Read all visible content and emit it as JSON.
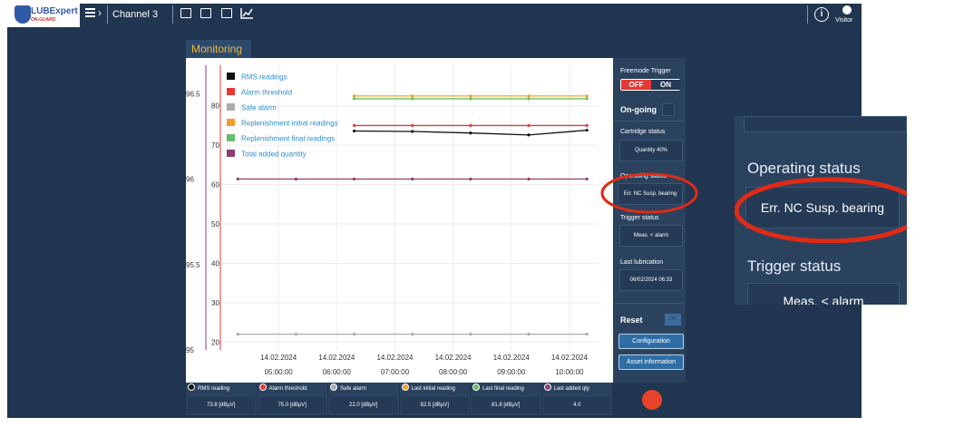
{
  "header": {
    "logo": "LUBExpert",
    "logo_sub": "ON-GUARD",
    "channel": "Channel 3",
    "user_label": "Visitor"
  },
  "panel": {
    "title": "Monitoring"
  },
  "right_panel": {
    "freemode_label": "Freemode Trigger",
    "off_label": "OFF",
    "on_label": "ON",
    "ongoing_label": "On-going",
    "cartridge_label": "Cartridge status",
    "cartridge_value": "Quantity 40%",
    "operating_label": "Operating status",
    "operating_value": "Err. NC Susp. bearing",
    "trigger_label": "Trigger status",
    "trigger_value": "Meas. < alarm",
    "lastlub_label": "Last lubrication",
    "lastlub_value": "06/02/2024 06:33",
    "reset_label": "Reset",
    "reset_btn": "OK",
    "config_btn": "Configuration",
    "asset_btn": "Asset information"
  },
  "zoom": {
    "operating_label": "Operating status",
    "operating_value": "Err. NC Susp. bearing",
    "trigger_label": "Trigger status",
    "trigger_value": "Meas. < alarm"
  },
  "footer": [
    {
      "label": "RMS reading",
      "value": "73.8 [dBµV]",
      "color": "#111111"
    },
    {
      "label": "Alarm threshold",
      "value": "75.0 [dBµV]",
      "color": "#e53935"
    },
    {
      "label": "Safe alarm",
      "value": "22.0 [dBµV]",
      "color": "#aaaaaa"
    },
    {
      "label": "Last initial reading",
      "value": "82.5 [dBµV]",
      "color": "#f59b2b"
    },
    {
      "label": "Last final reading",
      "value": "81.8 [dBµV]",
      "color": "#66bb6a"
    },
    {
      "label": "Last added qty",
      "value": "4.0",
      "color": "#8e3d73"
    }
  ],
  "chart_data": {
    "type": "line",
    "y_left_ticks": [
      "95",
      "95.5",
      "96",
      "96.5"
    ],
    "y_left_range": [
      95,
      97
    ],
    "y_right_ticks": [
      "20",
      "30",
      "40",
      "50",
      "60",
      "70",
      "80"
    ],
    "y_right_range": [
      18,
      88
    ],
    "x_ticks": [
      {
        "date": "14.02.2024",
        "time": "05:00:00"
      },
      {
        "date": "14.02.2024",
        "time": "06:00:00"
      },
      {
        "date": "14.02.2024",
        "time": "07:00:00"
      },
      {
        "date": "14.02.2024",
        "time": "08:00:00"
      },
      {
        "date": "14.02.2024",
        "time": "09:00:00"
      },
      {
        "date": "14.02.2024",
        "time": "10:00:00"
      }
    ],
    "legend": [
      {
        "name": "RMS readings",
        "color": "#111111"
      },
      {
        "name": "Alarm threshold",
        "color": "#e53935"
      },
      {
        "name": "Safe alarm",
        "color": "#aaaaaa"
      },
      {
        "name": "Replenishment initial readings",
        "color": "#f59b2b"
      },
      {
        "name": "Replenishment final readings",
        "color": "#66bb6a"
      },
      {
        "name": "Total added quantity",
        "color": "#8e3d73"
      }
    ],
    "x": [
      4.3,
      5.3,
      6.3,
      7.3,
      8.3,
      9.3,
      10.3
    ],
    "series": [
      {
        "name": "RMS readings",
        "axis": "right",
        "color": "#111111",
        "start": 2,
        "values": [
          73.0,
          73.4,
          73.6,
          73.5,
          73.1,
          72.6,
          73.8
        ]
      },
      {
        "name": "Alarm threshold",
        "axis": "right",
        "color": "#e53935",
        "start": 2,
        "values": [
          75.0,
          75.0,
          75.0,
          75.0,
          75.0,
          75.0,
          75.0
        ]
      },
      {
        "name": "Safe alarm",
        "axis": "right",
        "color": "#aaaaaa",
        "start": 0,
        "values": [
          22.0,
          22.0,
          22.0,
          22.0,
          22.0,
          22.0,
          22.0
        ]
      },
      {
        "name": "Replenishment initial readings",
        "axis": "right",
        "color": "#f59b2b",
        "start": 2,
        "values": [
          82.5,
          82.5,
          82.5,
          82.5,
          82.5,
          82.5,
          82.5
        ]
      },
      {
        "name": "Replenishment final readings",
        "axis": "right",
        "color": "#66bb6a",
        "start": 2,
        "values": [
          81.8,
          81.8,
          81.8,
          81.8,
          81.8,
          81.8,
          81.8
        ]
      },
      {
        "name": "Total added quantity",
        "axis": "left",
        "color": "#8e3d73",
        "start": 0,
        "values": [
          96,
          96,
          96,
          96,
          96,
          96,
          96
        ]
      }
    ]
  }
}
